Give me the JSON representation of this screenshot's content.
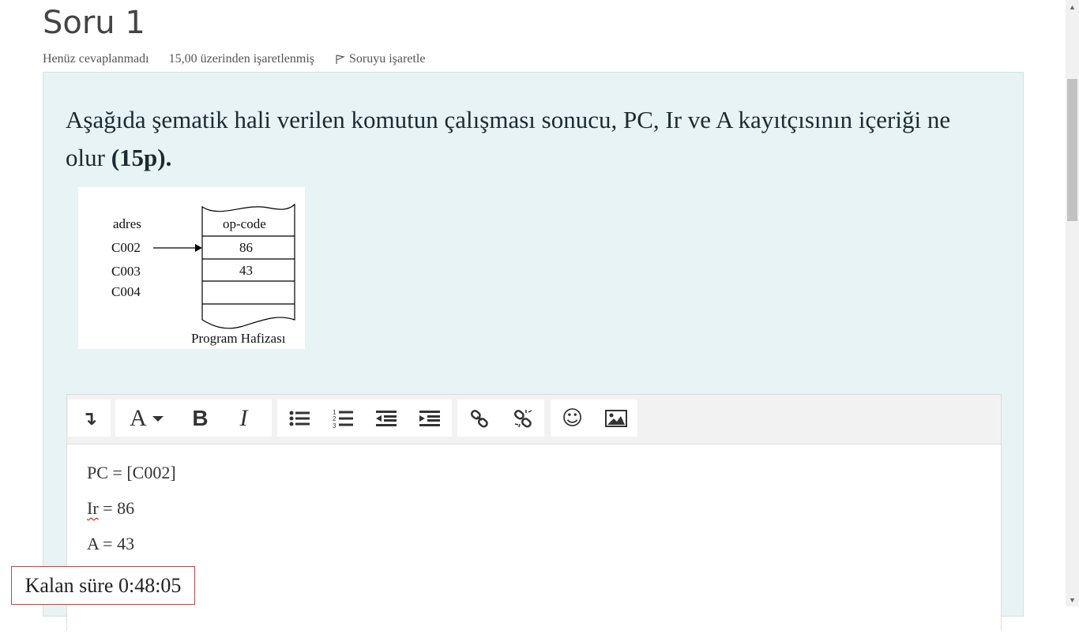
{
  "question": {
    "title": "Soru 1",
    "status": "Henüz cevaplanmadı",
    "marks": "15,00 üzerinden işaretlenmiş",
    "flag_label": "Soruyu işaretle",
    "text_main": "Aşağıda şematik hali verilen komutun çalışması sonucu, PC, Ir ve A kayıtçısının içeriği ne olur",
    "text_bold": "(15p)."
  },
  "figure": {
    "addr_header": "adres",
    "mem_header": "op-code",
    "addresses": [
      "C002",
      "C003",
      "C004"
    ],
    "values": [
      "86",
      "43"
    ],
    "caption": "Program Hafizası"
  },
  "editor": {
    "toolbar_icons": [
      "collapse-icon",
      "font-color-icon",
      "bold-icon",
      "italic-icon",
      "unordered-list-icon",
      "ordered-list-icon",
      "outdent-icon",
      "indent-icon",
      "link-icon",
      "unlink-icon",
      "emoji-icon",
      "image-icon"
    ],
    "toolbar_glyphs": {
      "bold": "B",
      "italic": "I",
      "font": "A",
      "collapse": "↴",
      "emoji": "☺"
    },
    "lines": {
      "pc": "PC = [C002]",
      "ir_label": "Ir",
      "ir_value": " = 86",
      "a": "A = 43"
    }
  },
  "timer": {
    "label": "Kalan süre 0:48:05"
  },
  "colors": {
    "question_bg": "#e7f3f5",
    "timer_border": "#b94a48"
  }
}
